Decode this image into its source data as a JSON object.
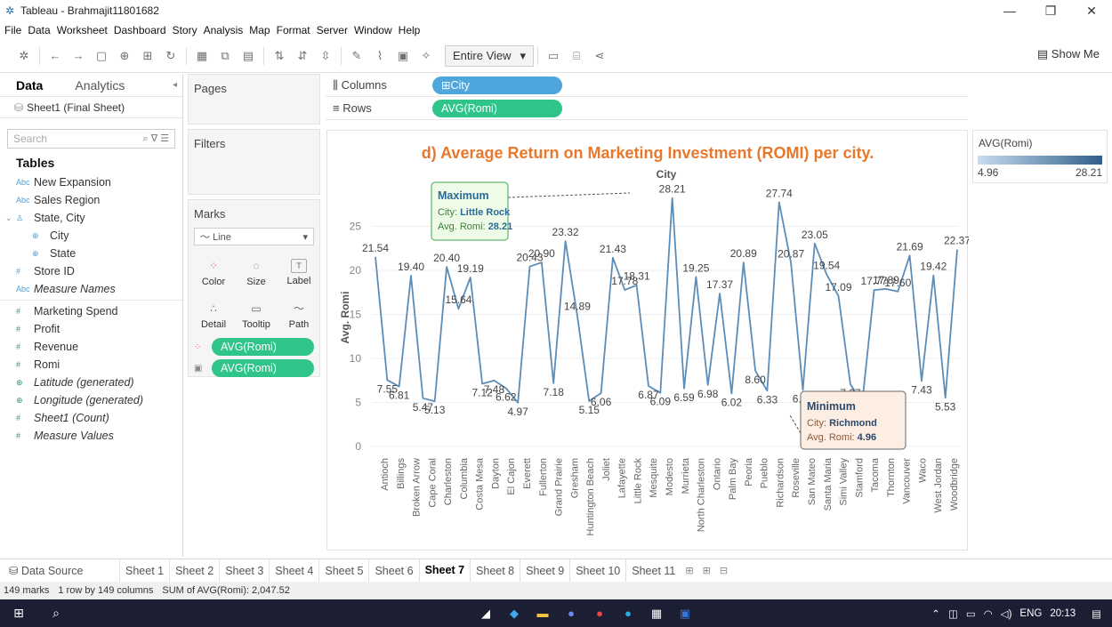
{
  "window": {
    "title": "Tableau - Brahmajit11801682",
    "minimize": "—",
    "restore": "❐",
    "close": "✕"
  },
  "menu": [
    "File",
    "Data",
    "Worksheet",
    "Dashboard",
    "Story",
    "Analysis",
    "Map",
    "Format",
    "Server",
    "Window",
    "Help"
  ],
  "toolbar": {
    "fit": "Entire View",
    "show_me": "Show Me"
  },
  "left": {
    "tab_data": "Data",
    "tab_analytics": "Analytics",
    "datasource": "Sheet1 (Final Sheet)",
    "search_placeholder": "Search",
    "tables_heading": "Tables",
    "fields": [
      {
        "label": "New Expansion",
        "icon": "Abc"
      },
      {
        "label": "Sales Region",
        "icon": "Abc"
      },
      {
        "label": "State, City",
        "icon": "♙"
      },
      {
        "label": "City",
        "icon": "⊕"
      },
      {
        "label": "State",
        "icon": "⊕"
      },
      {
        "label": "Store ID",
        "icon": "#"
      },
      {
        "label": "Measure Names",
        "icon": "Abc"
      },
      {
        "label": "Marketing Spend",
        "icon": "#"
      },
      {
        "label": "Profit",
        "icon": "#"
      },
      {
        "label": "Revenue",
        "icon": "#"
      },
      {
        "label": "Romi",
        "icon": "#"
      },
      {
        "label": "Latitude (generated)",
        "icon": "⊕"
      },
      {
        "label": "Longitude (generated)",
        "icon": "⊕"
      },
      {
        "label": "Sheet1 (Count)",
        "icon": "#"
      },
      {
        "label": "Measure Values",
        "icon": "#"
      }
    ]
  },
  "cards": {
    "pages": "Pages",
    "filters": "Filters",
    "marks": "Marks",
    "mark_type": "Line",
    "buttons": [
      "Color",
      "Size",
      "Label",
      "Detail",
      "Tooltip",
      "Path"
    ],
    "pill_color": "AVG(Romi)",
    "pill_label": "AVG(Romi)"
  },
  "shelves": {
    "columns_label": "Columns",
    "columns_pill": "City",
    "rows_label": "Rows",
    "rows_pill": "AVG(Romi)"
  },
  "legend": {
    "title": "AVG(Romi)",
    "min": "4.96",
    "max": "28.21"
  },
  "tabs": {
    "data_source": "Data Source",
    "sheets": [
      "Sheet 1",
      "Sheet 2",
      "Sheet 3",
      "Sheet 4",
      "Sheet 5",
      "Sheet 6",
      "Sheet 7",
      "Sheet 8",
      "Sheet 9",
      "Sheet 10",
      "Sheet 11"
    ],
    "active": "Sheet 7"
  },
  "status": {
    "marks": "149 marks",
    "rows": "1 row by 149 columns",
    "sum": "SUM of AVG(Romi): 2,047.52"
  },
  "tray": {
    "lang": "ENG",
    "time": "20:13"
  },
  "colors": {
    "pill_green": "#2fc48a",
    "pill_blue": "#4ea6dd",
    "line": "#5b8db8",
    "title_orange": "#e8782c"
  },
  "chart_data": {
    "type": "line",
    "title": "d) Average Return on Marketing Investment (ROMI) per city.",
    "xlabel": "City",
    "ylabel": "Avg. Romi",
    "ylim": [
      0,
      30
    ],
    "yticks": [
      0,
      5,
      10,
      15,
      20,
      25
    ],
    "categories": [
      "Antioch",
      "Billings",
      "Broken Arrow",
      "Cape Coral",
      "Charleston",
      "Columbia",
      "Costa Mesa",
      "Dayton",
      "El Cajon",
      "Everett",
      "Fullerton",
      "Grand Prairie",
      "Gresham",
      "Huntington Beach",
      "Joliet",
      "Lafayette",
      "Little Rock",
      "Mesquite",
      "Modesto",
      "Murrieta",
      "North Charleston",
      "Ontario",
      "Palm Bay",
      "Peoria",
      "Pueblo",
      "Richardson",
      "Roseville",
      "San Mateo",
      "Santa Maria",
      "Simi Valley",
      "Stamford",
      "Tacoma",
      "Thornton",
      "Vancouver",
      "Waco",
      "West Jordan",
      "Woodbridge"
    ],
    "values": [
      21.54,
      7.55,
      6.81,
      19.4,
      5.47,
      5.13,
      20.4,
      15.64,
      19.19,
      7.12,
      7.48,
      6.62,
      4.97,
      20.43,
      20.9,
      7.18,
      23.32,
      14.89,
      5.15,
      6.06,
      21.43,
      17.78,
      18.31,
      6.87,
      6.09,
      28.21,
      6.59,
      19.25,
      6.98,
      17.37,
      6.02,
      20.89,
      8.6,
      6.33,
      27.74,
      20.87,
      6.41,
      23.05,
      19.54,
      17.09,
      7.07,
      4.96,
      17.77,
      17.89,
      17.6,
      21.69,
      7.43,
      19.42,
      5.53,
      22.37
    ],
    "annotations": [
      {
        "heading": "Maximum",
        "city_label": "City:",
        "city": "Little Rock",
        "value_label": "Avg. Romi:",
        "value": "28.21"
      },
      {
        "heading": "Minimum",
        "city_label": "City:",
        "city": "Richmond",
        "value_label": "Avg. Romi:",
        "value": "4.96"
      }
    ]
  }
}
